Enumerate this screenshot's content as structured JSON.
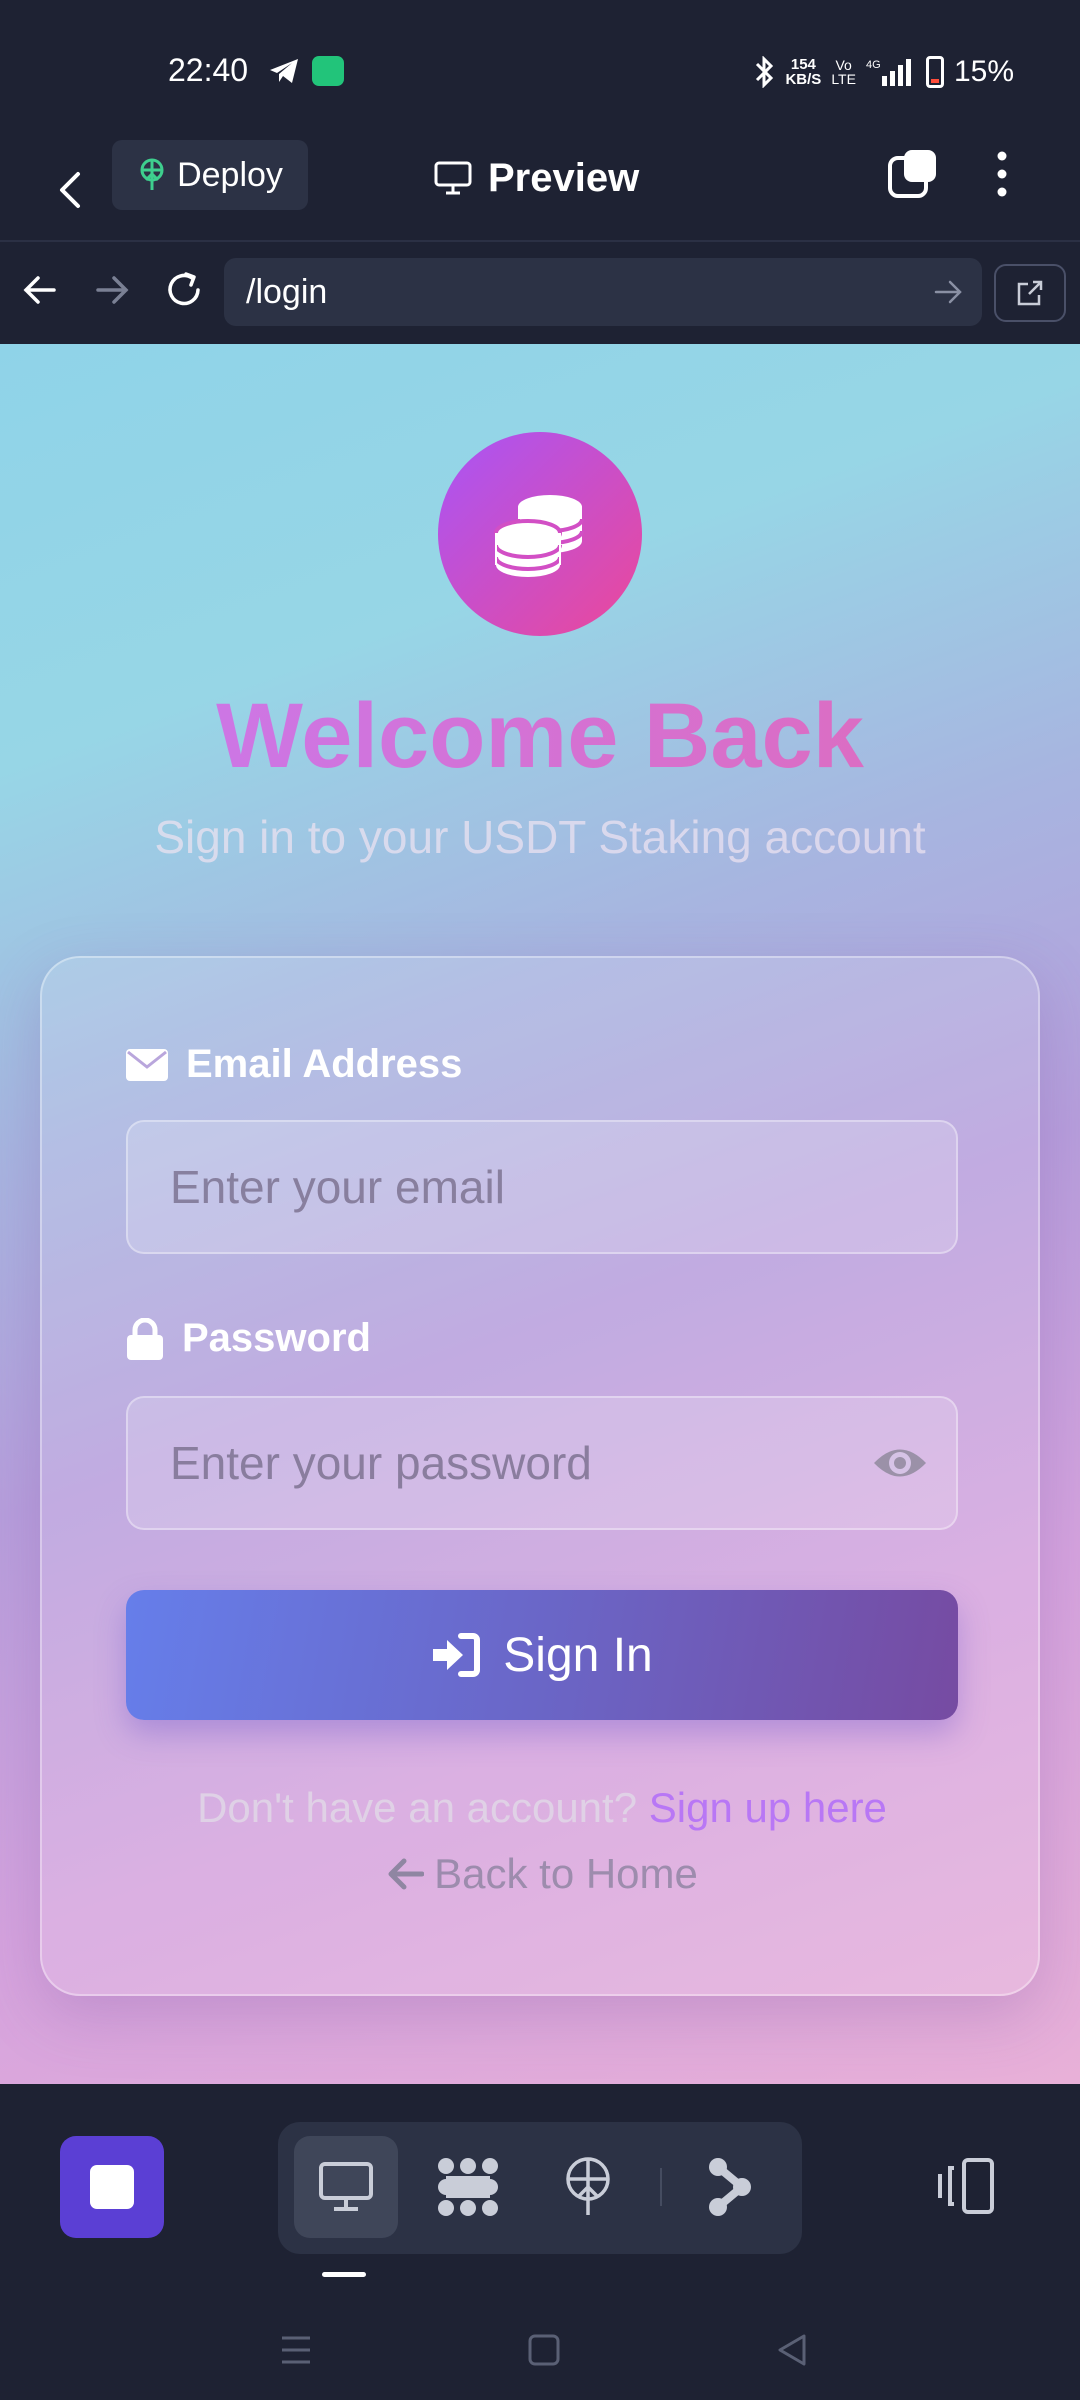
{
  "status_bar": {
    "time": "22:40",
    "net_speed_value": "154",
    "net_speed_unit": "KB/S",
    "volte_top": "Vo",
    "volte_bottom": "LTE",
    "network": "4G",
    "battery": "15%"
  },
  "app_header": {
    "deploy_label": "Deploy",
    "title": "Preview"
  },
  "browser": {
    "url": "/login"
  },
  "page": {
    "heading": "Welcome Back",
    "subtitle": "Sign in to your USDT Staking account",
    "email_label": "Email Address",
    "email_placeholder": "Enter your email",
    "password_label": "Password",
    "password_placeholder": "Enter your password",
    "signin_label": "Sign In",
    "signup_prompt": "Don't have an account?",
    "signup_link": "Sign up here",
    "back_home": "Back to Home"
  },
  "colors": {
    "app_bg": "#1e2233",
    "accent_purple": "#5b3fd4",
    "button_gradient_start": "#667eea",
    "button_gradient_end": "#764ba2",
    "link": "#b877f5"
  },
  "icons": {
    "toolbar": [
      "monitor-icon",
      "apps-icon",
      "deploy-icon",
      "share-icon",
      "devices-icon"
    ]
  }
}
